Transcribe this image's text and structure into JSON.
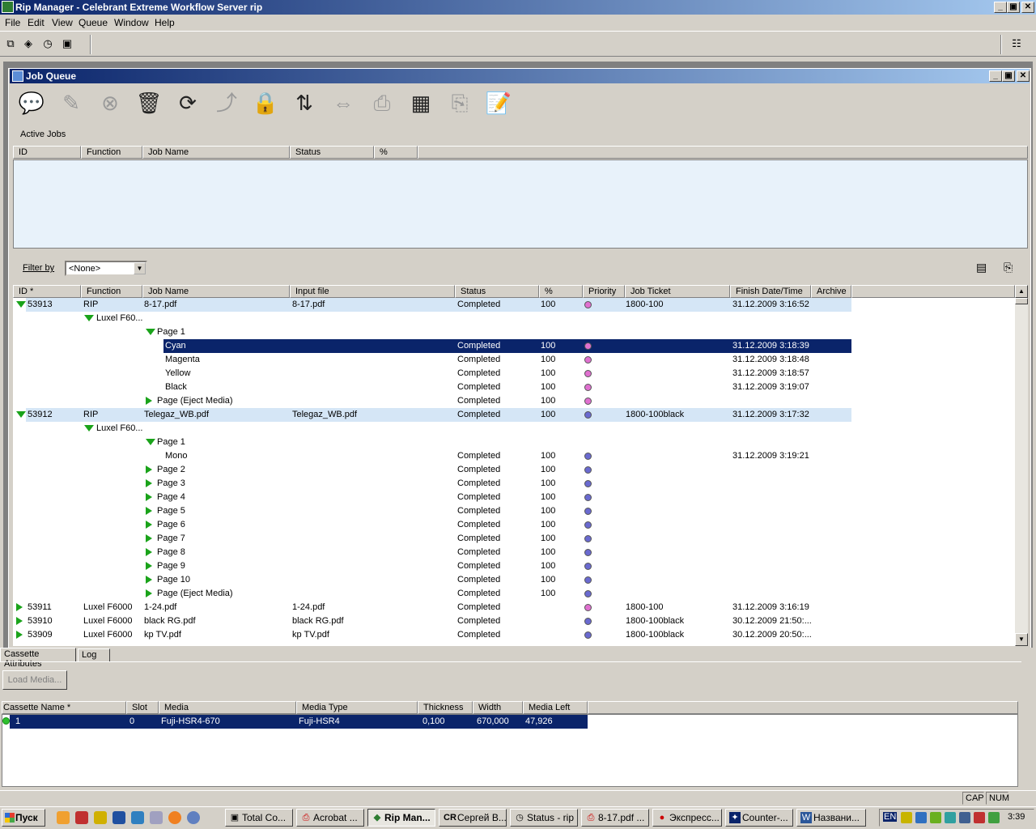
{
  "app": {
    "title": "Rip Manager - Celebrant Extreme Workflow Server rip"
  },
  "window_buttons": {
    "minimize": "_",
    "maximize": "▣",
    "close": "✕"
  },
  "menu": [
    "File",
    "Edit",
    "View",
    "Queue",
    "Window",
    "Help"
  ],
  "job_queue": {
    "title": "Job Queue",
    "active_jobs_label": "Active Jobs",
    "active_columns": [
      "ID",
      "Function",
      "Job Name",
      "Status",
      "%"
    ],
    "filter_label": "Filter by",
    "filter_value": "<None>",
    "columns": [
      "ID *",
      "Function",
      "Job Name",
      "Input file",
      "Status",
      "%",
      "Priority",
      "Job Ticket",
      "Finish Date/Time",
      "Archive"
    ],
    "rows": [
      {
        "level": 0,
        "exp": "down",
        "id": "53913",
        "func": "RIP",
        "name": "8-17.pdf",
        "input": "8-17.pdf",
        "status": "Completed",
        "pct": "100",
        "prio": "#e070d0",
        "ticket": "1800-100",
        "finish": "31.12.2009 3:16:52",
        "hl": "light"
      },
      {
        "level": 1,
        "exp": "down",
        "name": "Luxel F60...",
        "status": "",
        "pct": "",
        "prio": "",
        "finish": ""
      },
      {
        "level": 2,
        "exp": "down",
        "name": "Page 1",
        "status": "",
        "pct": "",
        "prio": "",
        "finish": ""
      },
      {
        "level": 3,
        "exp": "",
        "name": "Cyan",
        "status": "Completed",
        "pct": "100",
        "prio": "#e070d0",
        "finish": "31.12.2009 3:18:39",
        "hl": "dark"
      },
      {
        "level": 3,
        "exp": "",
        "name": "Magenta",
        "status": "Completed",
        "pct": "100",
        "prio": "#e070d0",
        "finish": "31.12.2009 3:18:48"
      },
      {
        "level": 3,
        "exp": "",
        "name": "Yellow",
        "status": "Completed",
        "pct": "100",
        "prio": "#e070d0",
        "finish": "31.12.2009 3:18:57"
      },
      {
        "level": 3,
        "exp": "",
        "name": "Black",
        "status": "Completed",
        "pct": "100",
        "prio": "#e070d0",
        "finish": "31.12.2009 3:19:07"
      },
      {
        "level": 2,
        "exp": "right",
        "name": "Page (Eject Media)",
        "status": "Completed",
        "pct": "100",
        "prio": "#e070d0",
        "finish": ""
      },
      {
        "level": 0,
        "exp": "down",
        "id": "53912",
        "func": "RIP",
        "name": "Telegaz_WB.pdf",
        "input": "Telegaz_WB.pdf",
        "status": "Completed",
        "pct": "100",
        "prio": "#6a6ad0",
        "ticket": "1800-100black",
        "finish": "31.12.2009 3:17:32",
        "hl": "light"
      },
      {
        "level": 1,
        "exp": "down",
        "name": "Luxel F60...",
        "status": "",
        "pct": "",
        "prio": "",
        "finish": ""
      },
      {
        "level": 2,
        "exp": "down",
        "name": "Page 1",
        "status": "",
        "pct": "",
        "prio": "",
        "finish": ""
      },
      {
        "level": 3,
        "exp": "",
        "name": "Mono",
        "status": "Completed",
        "pct": "100",
        "prio": "#6a6ad0",
        "finish": "31.12.2009 3:19:21"
      },
      {
        "level": 2,
        "exp": "right",
        "name": "Page 2",
        "status": "Completed",
        "pct": "100",
        "prio": "#6a6ad0",
        "finish": ""
      },
      {
        "level": 2,
        "exp": "right",
        "name": "Page 3",
        "status": "Completed",
        "pct": "100",
        "prio": "#6a6ad0",
        "finish": ""
      },
      {
        "level": 2,
        "exp": "right",
        "name": "Page 4",
        "status": "Completed",
        "pct": "100",
        "prio": "#6a6ad0",
        "finish": ""
      },
      {
        "level": 2,
        "exp": "right",
        "name": "Page 5",
        "status": "Completed",
        "pct": "100",
        "prio": "#6a6ad0",
        "finish": ""
      },
      {
        "level": 2,
        "exp": "right",
        "name": "Page 6",
        "status": "Completed",
        "pct": "100",
        "prio": "#6a6ad0",
        "finish": ""
      },
      {
        "level": 2,
        "exp": "right",
        "name": "Page 7",
        "status": "Completed",
        "pct": "100",
        "prio": "#6a6ad0",
        "finish": ""
      },
      {
        "level": 2,
        "exp": "right",
        "name": "Page 8",
        "status": "Completed",
        "pct": "100",
        "prio": "#6a6ad0",
        "finish": ""
      },
      {
        "level": 2,
        "exp": "right",
        "name": "Page 9",
        "status": "Completed",
        "pct": "100",
        "prio": "#6a6ad0",
        "finish": ""
      },
      {
        "level": 2,
        "exp": "right",
        "name": "Page 10",
        "status": "Completed",
        "pct": "100",
        "prio": "#6a6ad0",
        "finish": ""
      },
      {
        "level": 2,
        "exp": "right",
        "name": "Page (Eject Media)",
        "status": "Completed",
        "pct": "100",
        "prio": "#6a6ad0",
        "finish": ""
      },
      {
        "level": 0,
        "exp": "right",
        "id": "53911",
        "func": "Luxel F6000",
        "name": "1-24.pdf",
        "input": "1-24.pdf",
        "status": "Completed",
        "pct": "",
        "prio": "#e070d0",
        "ticket": "1800-100",
        "finish": "31.12.2009 3:16:19"
      },
      {
        "level": 0,
        "exp": "right",
        "id": "53910",
        "func": "Luxel F6000",
        "name": "black RG.pdf",
        "input": "black RG.pdf",
        "status": "Completed",
        "pct": "",
        "prio": "#6a6ad0",
        "ticket": "1800-100black",
        "finish": "30.12.2009 21:50:..."
      },
      {
        "level": 0,
        "exp": "right",
        "id": "53909",
        "func": "Luxel F6000",
        "name": "kp TV.pdf",
        "input": "kp TV.pdf",
        "status": "Completed",
        "pct": "",
        "prio": "#6a6ad0",
        "ticket": "1800-100black",
        "finish": "30.12.2009 20:50:..."
      }
    ]
  },
  "bottom_tabs": [
    "Cassette Attributes",
    "Log"
  ],
  "load_media_label": "Load Media...",
  "cassette": {
    "columns": [
      "Cassette Name *",
      "Slot",
      "Media",
      "Media Type",
      "Thickness",
      "Width",
      "Media Left"
    ],
    "rows": [
      {
        "name": "1",
        "slot": "0",
        "media": "Fuji-HSR4-670",
        "type": "Fuji-HSR4",
        "thickness": "0,100",
        "width": "670,000",
        "left": "47,926"
      }
    ]
  },
  "status": {
    "cap": "CAP",
    "num": "NUM"
  },
  "taskbar": {
    "start": "Пуск",
    "tasks": [
      "Total Co...",
      "Acrobat ...",
      "Rip Man...",
      "Сергей В...",
      "Status - rip",
      "8-17.pdf ...",
      "Экспресс...",
      "Counter-...",
      "Названи..."
    ],
    "task_prefix_cr": "CR",
    "lang": "EN",
    "clock": "3:39"
  }
}
